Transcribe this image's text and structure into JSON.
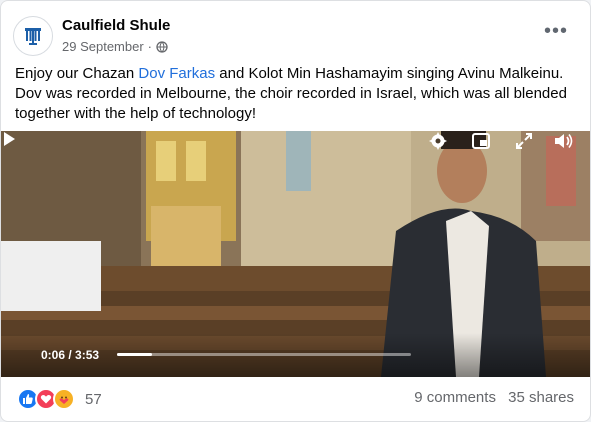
{
  "post": {
    "page_name": "Caulfield Shule",
    "date": "29 September",
    "separator": "·",
    "privacy_icon": "globe-icon",
    "more_icon": "more-options-icon",
    "more_label": "•••",
    "text_before": "Enjoy our Chazan ",
    "mention": "Dov Farkas",
    "text_after": " and Kolot Min Hashamayim singing Avinu Malkeinu. Dov was recorded in Melbourne, the choir recorded in Israel, which was all blended together with the help of technology!"
  },
  "video": {
    "time": "0:06 / 3:53",
    "progress_percent": 2.6,
    "icons": [
      "play-icon",
      "settings-icon",
      "picture-in-picture-icon",
      "fullscreen-icon",
      "volume-icon"
    ]
  },
  "footer": {
    "reactions": [
      "like-icon",
      "love-icon",
      "care-icon"
    ],
    "reaction_count": "57",
    "comments": "9 comments",
    "shares": "35 shares"
  },
  "colors": {
    "link": "#216fdb",
    "like": "#1877f2",
    "love": "#f33e58",
    "care": "#f7b125",
    "muted": "#65676b"
  }
}
